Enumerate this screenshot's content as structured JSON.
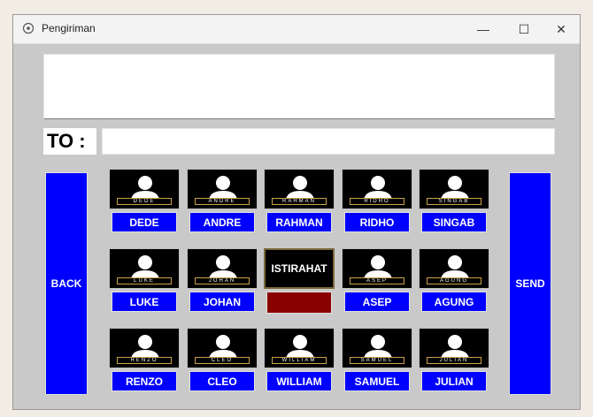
{
  "window": {
    "title": "Pengiriman",
    "controls": {
      "minimize": "—",
      "maximize": "☐",
      "close": "✕"
    }
  },
  "message": {
    "value": ""
  },
  "to": {
    "label": "TO :",
    "value": ""
  },
  "buttons": {
    "back": "BACK",
    "send": "SEND"
  },
  "contacts": {
    "row1": [
      {
        "name": "DEDE",
        "plate": "DEDE"
      },
      {
        "name": "ANDRE",
        "plate": "ANDRE"
      },
      {
        "name": "RAHMAN",
        "plate": "RAHMAN"
      },
      {
        "name": "RIDHO",
        "plate": "RIDHO"
      },
      {
        "name": "SINGAB",
        "plate": "SINGAB"
      }
    ],
    "row2": [
      {
        "name": "LUKE",
        "plate": "LUKE"
      },
      {
        "name": "JOHAN",
        "plate": "JOHAN"
      },
      {
        "name": "ASEP",
        "plate": "ASEP"
      },
      {
        "name": "AGUNG",
        "plate": "AGUNG"
      }
    ],
    "row3": [
      {
        "name": "RENZO",
        "plate": "RENZO"
      },
      {
        "name": "CLEO",
        "plate": "CLEO"
      },
      {
        "name": "WILLIAM",
        "plate": "WILLIAM"
      },
      {
        "name": "SAMUEL",
        "plate": "SAMUEL"
      },
      {
        "name": "JULIAN",
        "plate": "JULIAN"
      }
    ]
  },
  "break_tile": {
    "label": "ISTIRAHAT",
    "status_color": "#8b0000"
  },
  "colors": {
    "button_blue": "#0000ff",
    "window_bg": "#c9c9c9"
  }
}
